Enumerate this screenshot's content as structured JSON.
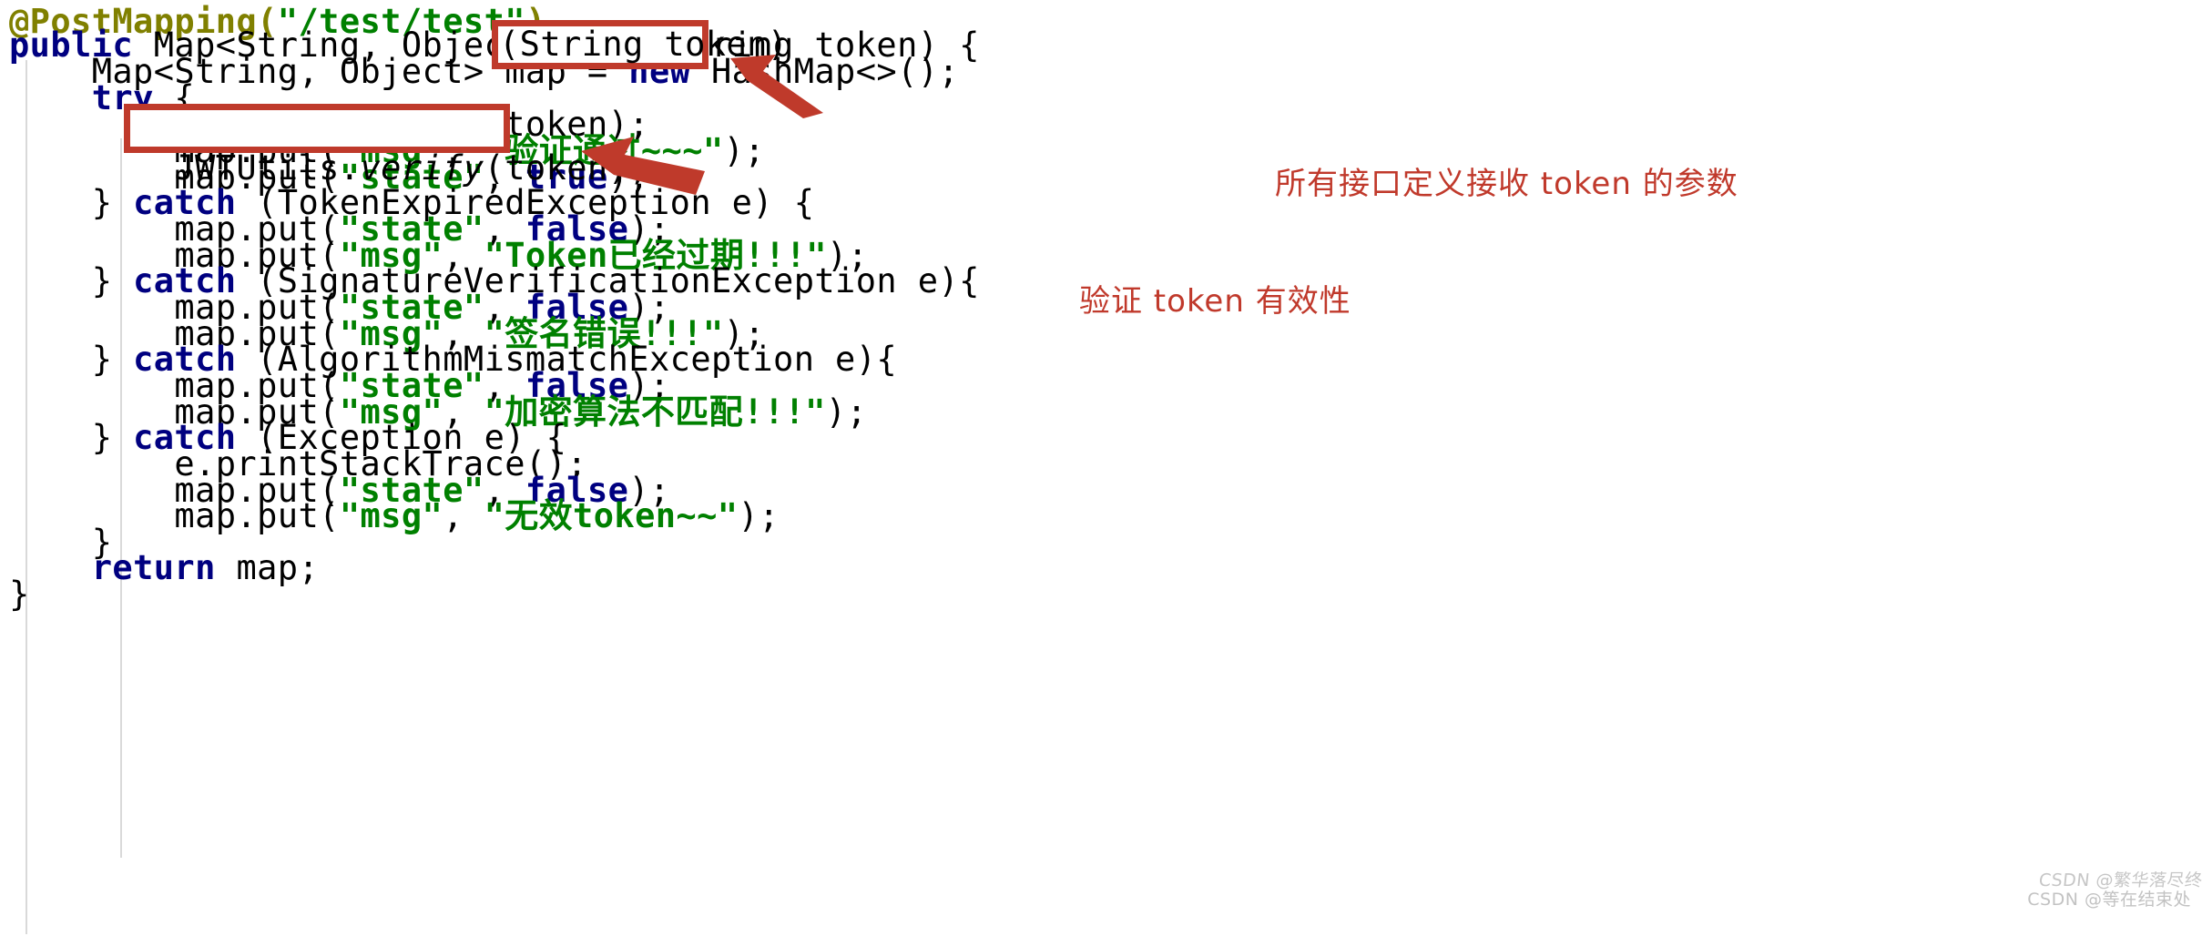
{
  "editor": {
    "language": "java",
    "background": "#ffffff",
    "colors": {
      "annotation": "#808000",
      "keyword": "#000080",
      "string": "#008000",
      "plain": "#000000",
      "indent_guide": "#d9d9d9",
      "marker_red": "#bf3a2b",
      "label_red": "#c0392b"
    },
    "lines": [
      {
        "n": 1,
        "indent": "",
        "text": "@PostMapping(\"/test/test\")"
      },
      {
        "n": 2,
        "indent": "",
        "text": "public Map<String, Object> test(String token) {"
      },
      {
        "n": 3,
        "indent": "    ",
        "text": "Map<String, Object> map = new HashMap<>();"
      },
      {
        "n": 4,
        "indent": "    ",
        "text": "try {"
      },
      {
        "n": 5,
        "indent": "        ",
        "text": "JWTUtils.verify(token);"
      },
      {
        "n": 6,
        "indent": "        ",
        "text": "map.put(\"msg\", \"验证通过~~~\");"
      },
      {
        "n": 7,
        "indent": "        ",
        "text": "map.put(\"state\", true);"
      },
      {
        "n": 8,
        "indent": "    ",
        "text": "} catch (TokenExpiredException e) {"
      },
      {
        "n": 9,
        "indent": "        ",
        "text": "map.put(\"state\", false);"
      },
      {
        "n": 10,
        "indent": "        ",
        "text": "map.put(\"msg\", \"Token已经过期!!!\");"
      },
      {
        "n": 11,
        "indent": "    ",
        "text": "} catch (SignatureVerificationException e){"
      },
      {
        "n": 12,
        "indent": "        ",
        "text": "map.put(\"state\", false);"
      },
      {
        "n": 13,
        "indent": "        ",
        "text": "map.put(\"msg\", \"签名错误!!!\");"
      },
      {
        "n": 14,
        "indent": "    ",
        "text": "} catch (AlgorithmMismatchException e){"
      },
      {
        "n": 15,
        "indent": "        ",
        "text": "map.put(\"state\", false);"
      },
      {
        "n": 16,
        "indent": "        ",
        "text": "map.put(\"msg\", \"加密算法不匹配!!!\");"
      },
      {
        "n": 17,
        "indent": "    ",
        "text": "} catch (Exception e) {"
      },
      {
        "n": 18,
        "indent": "        ",
        "text": "e.printStackTrace();"
      },
      {
        "n": 19,
        "indent": "        ",
        "text": "map.put(\"state\", false);"
      },
      {
        "n": 20,
        "indent": "        ",
        "text": "map.put(\"msg\", \"无效token~~\");"
      },
      {
        "n": 21,
        "indent": "    ",
        "text": "}"
      },
      {
        "n": 22,
        "indent": "    ",
        "text": "return map;"
      },
      {
        "n": 23,
        "indent": "",
        "text": "}"
      }
    ],
    "line_segments": {
      "l1": [
        {
          "t": "@PostMapping(",
          "c": "ann"
        },
        {
          "t": "\"",
          "c": "quote"
        },
        {
          "t": "/test/test",
          "c": "str"
        },
        {
          "t": "\"",
          "c": "quote"
        },
        {
          "t": ")",
          "c": "ann"
        }
      ],
      "l2": [
        {
          "t": "public",
          "c": "kw"
        },
        {
          "t": " Map<String, Object> test(String token) {",
          "c": "plain"
        }
      ],
      "l3": [
        {
          "t": "    Map<String, Object> map = ",
          "c": "plain"
        },
        {
          "t": "new",
          "c": "kw"
        },
        {
          "t": " HashMap<>();",
          "c": "plain"
        }
      ],
      "l4": [
        {
          "t": "    ",
          "c": "plain"
        },
        {
          "t": "try",
          "c": "kw"
        },
        {
          "t": " {",
          "c": "plain"
        }
      ],
      "l5": [
        {
          "t": "        JWTUtils.",
          "c": "plain"
        },
        {
          "t": "verify",
          "c": "ital"
        },
        {
          "t": "(token);",
          "c": "plain"
        }
      ],
      "l6": [
        {
          "t": "        map.put(",
          "c": "plain"
        },
        {
          "t": "\"msg\"",
          "c": "str"
        },
        {
          "t": ", ",
          "c": "plain"
        },
        {
          "t": "\"验证通过~~~\"",
          "c": "str"
        },
        {
          "t": ");",
          "c": "plain"
        }
      ],
      "l7": [
        {
          "t": "        map.put(",
          "c": "plain"
        },
        {
          "t": "\"state\"",
          "c": "str"
        },
        {
          "t": ", ",
          "c": "plain"
        },
        {
          "t": "true",
          "c": "kw"
        },
        {
          "t": ");",
          "c": "plain"
        }
      ],
      "l8": [
        {
          "t": "    } ",
          "c": "plain"
        },
        {
          "t": "catch",
          "c": "kw"
        },
        {
          "t": " (TokenExpiredException e) {",
          "c": "plain"
        }
      ],
      "l9": [
        {
          "t": "        map.put(",
          "c": "plain"
        },
        {
          "t": "\"state\"",
          "c": "str"
        },
        {
          "t": ", ",
          "c": "plain"
        },
        {
          "t": "false",
          "c": "kw"
        },
        {
          "t": ");",
          "c": "plain"
        }
      ],
      "l10": [
        {
          "t": "        map.put(",
          "c": "plain"
        },
        {
          "t": "\"msg\"",
          "c": "str"
        },
        {
          "t": ", ",
          "c": "plain"
        },
        {
          "t": "\"Token已经过期!!!\"",
          "c": "str"
        },
        {
          "t": ");",
          "c": "plain"
        }
      ],
      "l11": [
        {
          "t": "    } ",
          "c": "plain"
        },
        {
          "t": "catch",
          "c": "kw"
        },
        {
          "t": " (SignatureVerificationException e){",
          "c": "plain"
        }
      ],
      "l12": [
        {
          "t": "        map.put(",
          "c": "plain"
        },
        {
          "t": "\"state\"",
          "c": "str"
        },
        {
          "t": ", ",
          "c": "plain"
        },
        {
          "t": "false",
          "c": "kw"
        },
        {
          "t": ");",
          "c": "plain"
        }
      ],
      "l13": [
        {
          "t": "        map.put(",
          "c": "plain"
        },
        {
          "t": "\"msg\"",
          "c": "str"
        },
        {
          "t": ", ",
          "c": "plain"
        },
        {
          "t": "\"签名错误!!!\"",
          "c": "str"
        },
        {
          "t": ");",
          "c": "plain"
        }
      ],
      "l14": [
        {
          "t": "    } ",
          "c": "plain"
        },
        {
          "t": "catch",
          "c": "kw"
        },
        {
          "t": " (AlgorithmMismatchException e){",
          "c": "plain"
        }
      ],
      "l15": [
        {
          "t": "        map.put(",
          "c": "plain"
        },
        {
          "t": "\"state\"",
          "c": "str"
        },
        {
          "t": ", ",
          "c": "plain"
        },
        {
          "t": "false",
          "c": "kw"
        },
        {
          "t": ");",
          "c": "plain"
        }
      ],
      "l16": [
        {
          "t": "        map.put(",
          "c": "plain"
        },
        {
          "t": "\"msg\"",
          "c": "str"
        },
        {
          "t": ", ",
          "c": "plain"
        },
        {
          "t": "\"加密算法不匹配!!!\"",
          "c": "str"
        },
        {
          "t": ");",
          "c": "plain"
        }
      ],
      "l17": [
        {
          "t": "    } ",
          "c": "plain"
        },
        {
          "t": "catch",
          "c": "kw"
        },
        {
          "t": " (Exception e) {",
          "c": "plain"
        }
      ],
      "l18": [
        {
          "t": "        e.printStackTrace();",
          "c": "plain"
        }
      ],
      "l19": [
        {
          "t": "        map.put(",
          "c": "plain"
        },
        {
          "t": "\"state\"",
          "c": "str"
        },
        {
          "t": ", ",
          "c": "plain"
        },
        {
          "t": "false",
          "c": "kw"
        },
        {
          "t": ");",
          "c": "plain"
        }
      ],
      "l20": [
        {
          "t": "        map.put(",
          "c": "plain"
        },
        {
          "t": "\"msg\"",
          "c": "str"
        },
        {
          "t": ", ",
          "c": "plain"
        },
        {
          "t": "\"无效token~~\"",
          "c": "str"
        },
        {
          "t": ");",
          "c": "plain"
        }
      ],
      "l21": [
        {
          "t": "    }",
          "c": "plain"
        }
      ],
      "l22": [
        {
          "t": "    ",
          "c": "plain"
        },
        {
          "t": "return",
          "c": "kw"
        },
        {
          "t": " map;",
          "c": "plain"
        }
      ],
      "l23": [
        {
          "t": "}",
          "c": "plain"
        }
      ]
    }
  },
  "annotations": {
    "box_token": {
      "text": "(String token)",
      "color": "#bf3a2b"
    },
    "box_verify": {
      "text": "JWTUtils.verify(token);",
      "color": "#bf3a2b"
    },
    "label_1": "所有接口定义接收 token 的参数",
    "label_2": "验证 token 有效性",
    "arrow_1_name": "arrow-pointing-to-token-param",
    "arrow_2_name": "arrow-pointing-to-verify-call"
  },
  "watermark": {
    "primary": "CSDN @等在结束处",
    "overlay": "CSDN @繁华落尽终将静寂"
  }
}
